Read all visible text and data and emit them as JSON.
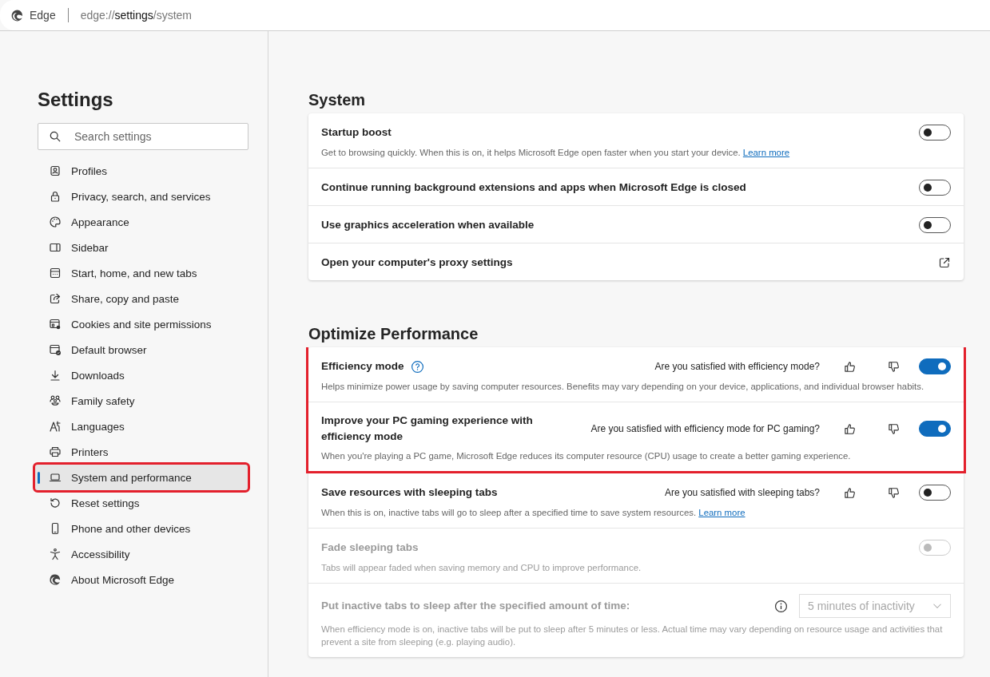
{
  "address_bar": {
    "browser_name": "Edge",
    "url_start": "edge://",
    "url_main": "settings",
    "url_end": "/system"
  },
  "sidebar": {
    "title": "Settings",
    "search": {
      "placeholder": "Search settings"
    },
    "items": [
      {
        "label": "Profiles",
        "selected": false,
        "highlighted": false
      },
      {
        "label": "Privacy, search, and services",
        "selected": false,
        "highlighted": false
      },
      {
        "label": "Appearance",
        "selected": false,
        "highlighted": false
      },
      {
        "label": "Sidebar",
        "selected": false,
        "highlighted": false
      },
      {
        "label": "Start, home, and new tabs",
        "selected": false,
        "highlighted": false
      },
      {
        "label": "Share, copy and paste",
        "selected": false,
        "highlighted": false
      },
      {
        "label": "Cookies and site permissions",
        "selected": false,
        "highlighted": false
      },
      {
        "label": "Default browser",
        "selected": false,
        "highlighted": false
      },
      {
        "label": "Downloads",
        "selected": false,
        "highlighted": false
      },
      {
        "label": "Family safety",
        "selected": false,
        "highlighted": false
      },
      {
        "label": "Languages",
        "selected": false,
        "highlighted": false
      },
      {
        "label": "Printers",
        "selected": false,
        "highlighted": false
      },
      {
        "label": "System and performance",
        "selected": true,
        "highlighted": true
      },
      {
        "label": "Reset settings",
        "selected": false,
        "highlighted": false
      },
      {
        "label": "Phone and other devices",
        "selected": false,
        "highlighted": false
      },
      {
        "label": "Accessibility",
        "selected": false,
        "highlighted": false
      },
      {
        "label": "About Microsoft Edge",
        "selected": false,
        "highlighted": false
      }
    ]
  },
  "sections": [
    {
      "heading": "System",
      "rows": [
        {
          "kind": "toggle",
          "title": "Startup boost",
          "description": "Get to browsing quickly. When this is on, it helps Microsoft Edge open faster when you start your device.",
          "link": "Learn more",
          "on": false,
          "disabled": false,
          "highlighted": false
        },
        {
          "kind": "toggle",
          "title": "Continue running background extensions and apps when Microsoft Edge is closed",
          "on": false,
          "disabled": false,
          "highlighted": false
        },
        {
          "kind": "toggle",
          "title": "Use graphics acceleration when available",
          "on": false,
          "disabled": false,
          "highlighted": false
        },
        {
          "kind": "external",
          "title": "Open your computer's proxy settings",
          "disabled": false,
          "highlighted": false
        }
      ]
    },
    {
      "heading": "Optimize Performance",
      "rows": [
        {
          "kind": "toggle",
          "title": "Efficiency mode",
          "help_icon": true,
          "feedback": "Are you satisfied with efficiency mode?",
          "description": "Helps minimize power usage by saving computer resources. Benefits may vary depending on your device, applications, and individual browser habits.",
          "on": true,
          "disabled": false,
          "highlighted": true
        },
        {
          "kind": "toggle",
          "title": "Improve your PC gaming experience with efficiency mode",
          "feedback": "Are you satisfied with efficiency mode for PC gaming?",
          "description": "When you're playing a PC game, Microsoft Edge reduces its computer resource (CPU) usage to create a better gaming experience.",
          "on": true,
          "disabled": false,
          "highlighted": true
        },
        {
          "kind": "toggle",
          "title": "Save resources with sleeping tabs",
          "feedback": "Are you satisfied with sleeping tabs?",
          "description": "When this is on, inactive tabs will go to sleep after a specified time to save system resources.",
          "link": "Learn more",
          "on": false,
          "disabled": false,
          "highlighted": false
        },
        {
          "kind": "toggle",
          "title": "Fade sleeping tabs",
          "description": "Tabs will appear faded when saving memory and CPU to improve performance.",
          "on": false,
          "disabled": true,
          "highlighted": false
        },
        {
          "kind": "select",
          "title": "Put inactive tabs to sleep after the specified amount of time:",
          "info_icon": true,
          "value": "5 minutes of inactivity",
          "description": "When efficiency mode is on, inactive tabs will be put to sleep after 5 minutes or less. Actual time may vary depending on resource usage and activities that prevent a site from sleeping (e.g. playing audio).",
          "disabled": true,
          "highlighted": false
        }
      ]
    }
  ]
}
